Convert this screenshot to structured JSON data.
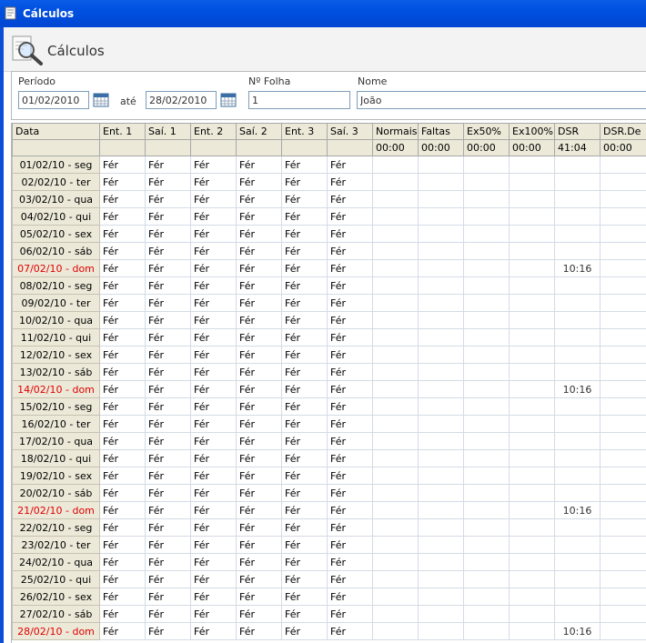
{
  "window": {
    "title": "Cálculos"
  },
  "header": {
    "title": "Cálculos",
    "icon": "search-document-icon"
  },
  "filters": {
    "period_label": "Período",
    "start_date": "01/02/2010",
    "until_label": "até",
    "end_date": "28/02/2010",
    "sheet_label": "Nº Folha",
    "sheet_value": "1",
    "name_label": "Nome",
    "name_value": "João"
  },
  "grid": {
    "columns": [
      "Data",
      "Ent. 1",
      "Saí. 1",
      "Ent. 2",
      "Saí. 2",
      "Ent. 3",
      "Saí. 3",
      "Normais",
      "Faltas",
      "Ex50%",
      "Ex100%",
      "DSR",
      "DSR.De"
    ],
    "totals": [
      "",
      "",
      "",
      "",
      "",
      "",
      "",
      "00:00",
      "00:00",
      "00:00",
      "00:00",
      "41:04",
      "00:00"
    ],
    "punch_value": "Fér",
    "rows": [
      {
        "date": "01/02/10 - seg",
        "sunday": false,
        "dsr": ""
      },
      {
        "date": "02/02/10 - ter",
        "sunday": false,
        "dsr": ""
      },
      {
        "date": "03/02/10 - qua",
        "sunday": false,
        "dsr": ""
      },
      {
        "date": "04/02/10 - qui",
        "sunday": false,
        "dsr": ""
      },
      {
        "date": "05/02/10 - sex",
        "sunday": false,
        "dsr": ""
      },
      {
        "date": "06/02/10 - sáb",
        "sunday": false,
        "dsr": ""
      },
      {
        "date": "07/02/10 - dom",
        "sunday": true,
        "dsr": "10:16"
      },
      {
        "date": "08/02/10 - seg",
        "sunday": false,
        "dsr": ""
      },
      {
        "date": "09/02/10 - ter",
        "sunday": false,
        "dsr": ""
      },
      {
        "date": "10/02/10 - qua",
        "sunday": false,
        "dsr": ""
      },
      {
        "date": "11/02/10 - qui",
        "sunday": false,
        "dsr": ""
      },
      {
        "date": "12/02/10 - sex",
        "sunday": false,
        "dsr": ""
      },
      {
        "date": "13/02/10 - sáb",
        "sunday": false,
        "dsr": ""
      },
      {
        "date": "14/02/10 - dom",
        "sunday": true,
        "dsr": "10:16"
      },
      {
        "date": "15/02/10 - seg",
        "sunday": false,
        "dsr": ""
      },
      {
        "date": "16/02/10 - ter",
        "sunday": false,
        "dsr": ""
      },
      {
        "date": "17/02/10 - qua",
        "sunday": false,
        "dsr": ""
      },
      {
        "date": "18/02/10 - qui",
        "sunday": false,
        "dsr": ""
      },
      {
        "date": "19/02/10 - sex",
        "sunday": false,
        "dsr": ""
      },
      {
        "date": "20/02/10 - sáb",
        "sunday": false,
        "dsr": ""
      },
      {
        "date": "21/02/10 - dom",
        "sunday": true,
        "dsr": "10:16"
      },
      {
        "date": "22/02/10 - seg",
        "sunday": false,
        "dsr": ""
      },
      {
        "date": "23/02/10 - ter",
        "sunday": false,
        "dsr": ""
      },
      {
        "date": "24/02/10 - qua",
        "sunday": false,
        "dsr": ""
      },
      {
        "date": "25/02/10 - qui",
        "sunday": false,
        "dsr": ""
      },
      {
        "date": "26/02/10 - sex",
        "sunday": false,
        "dsr": ""
      },
      {
        "date": "27/02/10 - sáb",
        "sunday": false,
        "dsr": ""
      },
      {
        "date": "28/02/10 - dom",
        "sunday": true,
        "dsr": "10:16"
      }
    ]
  },
  "colors": {
    "titlebar": "#0050e0",
    "sunday_text": "#e00000",
    "header_bg": "#ece9d8"
  }
}
